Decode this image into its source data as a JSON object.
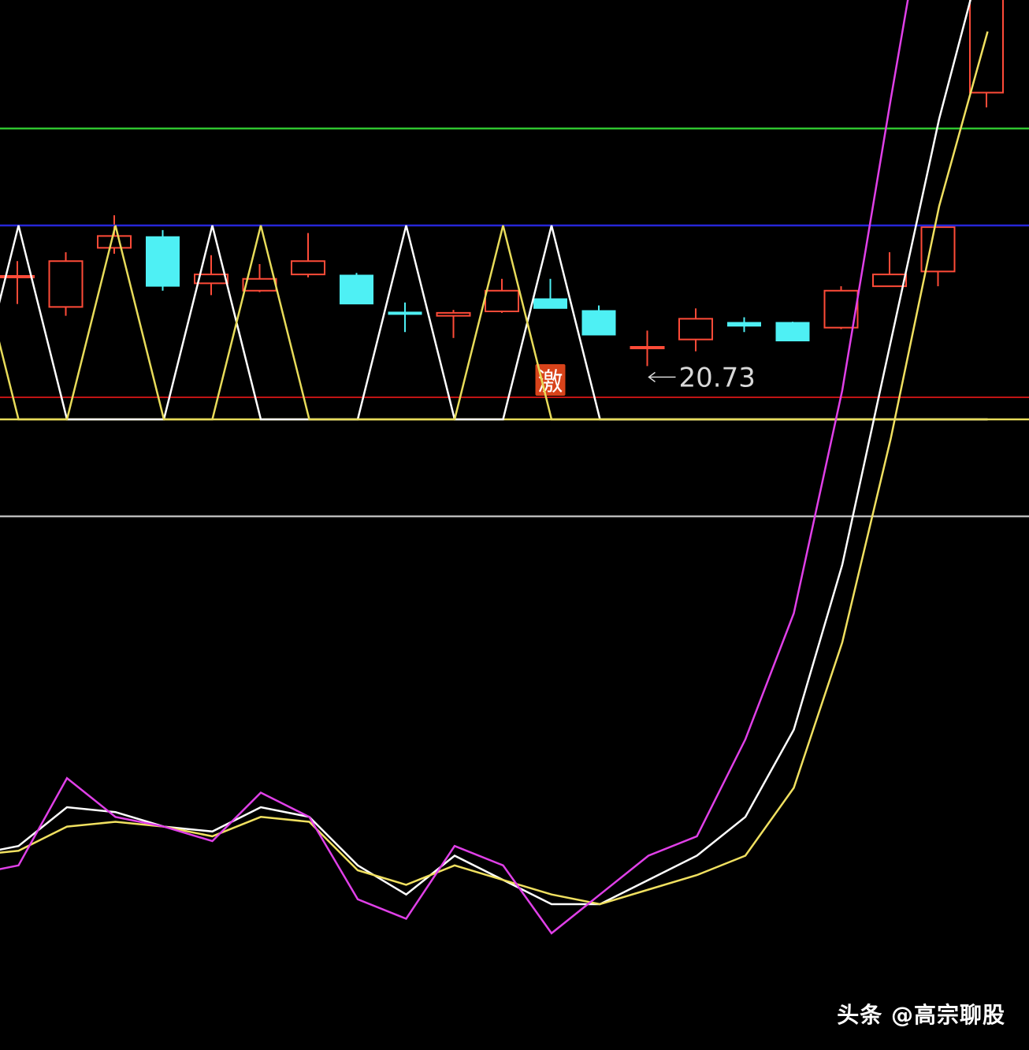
{
  "chart_data": {
    "type": "candlestick",
    "price_panel": {
      "low_annotation": {
        "text": "20.73",
        "candle_index": 13
      },
      "signal_marker": {
        "text": "激",
        "candle_index": 11
      },
      "reference_line_color": "#c01414",
      "up_color": "#ff4b38",
      "down_color": "#4ef0f4",
      "candles": [
        {
          "open": 21.25,
          "close": 21.25,
          "high": 21.35,
          "low": 21.06
        },
        {
          "open": 21.04,
          "close": 21.35,
          "high": 21.41,
          "low": 20.98
        },
        {
          "open": 21.44,
          "close": 21.52,
          "high": 21.66,
          "low": 21.4
        },
        {
          "open": 21.51,
          "close": 21.18,
          "high": 21.56,
          "low": 21.15
        },
        {
          "open": 21.2,
          "close": 21.26,
          "high": 21.39,
          "low": 21.12
        },
        {
          "open": 21.15,
          "close": 21.23,
          "high": 21.33,
          "low": 21.14
        },
        {
          "open": 21.26,
          "close": 21.35,
          "high": 21.54,
          "low": 21.24
        },
        {
          "open": 21.25,
          "close": 21.06,
          "high": 21.27,
          "low": 21.06
        },
        {
          "open": 21.0,
          "close": 20.99,
          "high": 21.07,
          "low": 20.87
        },
        {
          "open": 20.98,
          "close": 21.0,
          "high": 21.02,
          "low": 20.83
        },
        {
          "open": 21.01,
          "close": 21.15,
          "high": 21.23,
          "low": 21.0
        },
        {
          "open": 21.09,
          "close": 21.03,
          "high": 21.23,
          "low": 21.03
        },
        {
          "open": 21.01,
          "close": 20.85,
          "high": 21.05,
          "low": 20.85
        },
        {
          "open": 20.77,
          "close": 20.77,
          "high": 20.88,
          "low": 20.64
        },
        {
          "open": 20.82,
          "close": 20.96,
          "high": 21.03,
          "low": 20.74
        },
        {
          "open": 20.93,
          "close": 20.91,
          "high": 20.97,
          "low": 20.87
        },
        {
          "open": 20.93,
          "close": 20.81,
          "high": 20.94,
          "low": 20.81
        },
        {
          "open": 20.9,
          "close": 21.15,
          "high": 21.18,
          "low": 20.89
        },
        {
          "open": 21.18,
          "close": 21.26,
          "high": 21.41,
          "low": 21.18
        },
        {
          "open": 21.28,
          "close": 21.58,
          "high": 21.58,
          "low": 21.18
        },
        {
          "open": 22.49,
          "close": 23.98,
          "high": 23.98,
          "low": 22.39
        }
      ]
    },
    "indicator_panel": {
      "x_count": 22,
      "ylim": [
        -10,
        100
      ],
      "hlines": [
        {
          "value": 80,
          "color": "#2fc42f"
        },
        {
          "value": 70,
          "color": "#2626d8"
        },
        {
          "value": 50,
          "color": "#e8dc5a"
        },
        {
          "value": 40,
          "color": "#b9b9b9"
        }
      ],
      "series": [
        {
          "color": "#ffffff",
          "values": [
            50,
            70,
            50,
            50,
            50,
            70,
            50,
            50,
            50,
            70,
            50,
            50,
            70,
            50,
            50,
            50,
            50,
            50,
            50,
            50,
            50,
            50
          ]
        },
        {
          "color": "#e8dc5a",
          "values": [
            70,
            50,
            50,
            70,
            50,
            50,
            70,
            50,
            50,
            50,
            50,
            70,
            50,
            50,
            50,
            50,
            50,
            50,
            50,
            50,
            50,
            50
          ]
        },
        {
          "color": "#ffffff",
          "values": [
            5,
            6,
            10,
            9.5,
            8,
            7.5,
            10,
            9,
            4,
            1,
            5,
            2.5,
            0,
            0,
            2.5,
            5,
            9,
            18,
            35,
            58,
            81,
            100
          ]
        },
        {
          "color": "#f0e060",
          "values": [
            5,
            5.5,
            8,
            8.5,
            8,
            7,
            9,
            8.5,
            3.5,
            2,
            4,
            2.5,
            1,
            0,
            1.5,
            3,
            5,
            12,
            27,
            48,
            72,
            90
          ]
        },
        {
          "color": "#e040e8",
          "values": [
            3,
            4,
            13,
            9,
            8,
            6.5,
            11.5,
            9,
            0.5,
            -1.5,
            6,
            4,
            -3,
            1,
            5,
            7,
            17,
            30,
            53,
            83,
            112,
            132
          ]
        }
      ]
    }
  },
  "watermark": "头条 @高宗聊股"
}
